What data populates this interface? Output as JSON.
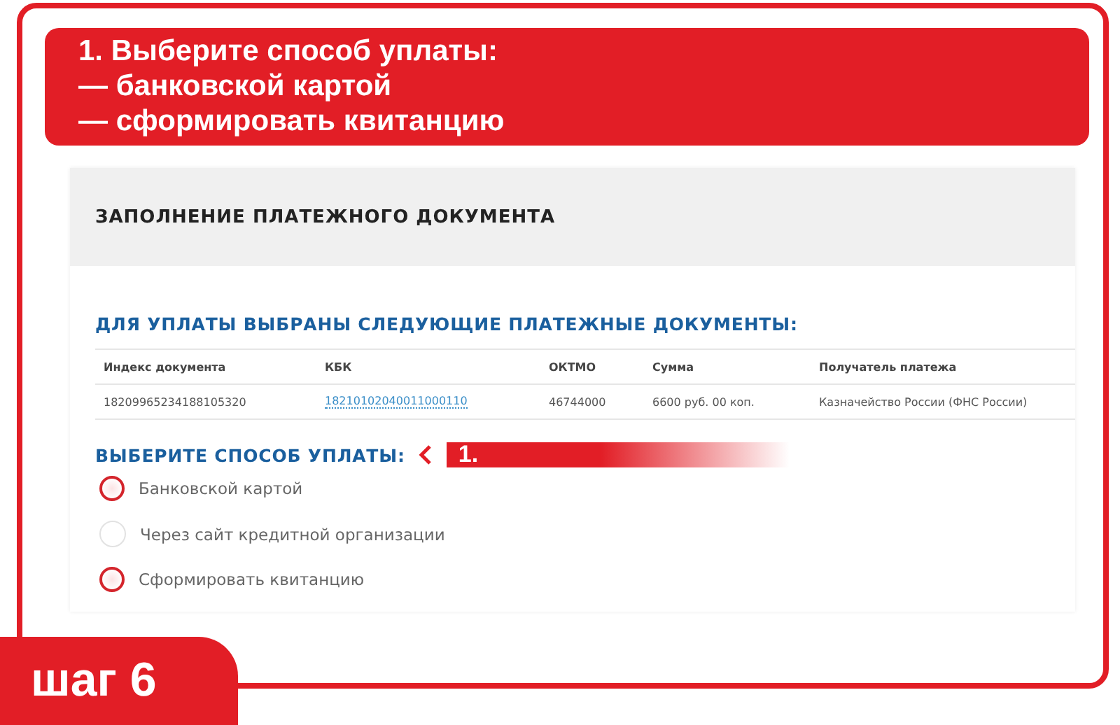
{
  "instruction": {
    "lines": [
      "1. Выберите способ уплаты:",
      "— банковской картой",
      "— сформировать квитанцию"
    ]
  },
  "page": {
    "title": "ЗАПОЛНЕНИЕ ПЛАТЕЖНОГО ДОКУМЕНТА",
    "documents_heading": "ДЛЯ УПЛАТЫ ВЫБРАНЫ СЛЕДУЮЩИЕ ПЛАТЕЖНЫЕ ДОКУМЕНТЫ:",
    "table": {
      "columns": [
        "Индекс документа",
        "КБК",
        "ОКТМО",
        "Сумма",
        "Получатель платежа"
      ],
      "rows": [
        [
          "18209965234188105320",
          "18210102040011000110",
          "46744000",
          "6600 руб. 00 коп.",
          "Казначейство России (ФНС России)"
        ]
      ]
    },
    "payment_heading": "ВЫБЕРИТЕ СПОСОБ УПЛАТЫ:",
    "callout": "1.",
    "options": [
      {
        "label": "Банковской картой",
        "highlighted": true
      },
      {
        "label": "Через сайт кредитной организации",
        "highlighted": false
      },
      {
        "label": "Сформировать квитанцию",
        "highlighted": true
      }
    ]
  },
  "step_badge": "шаг 6"
}
